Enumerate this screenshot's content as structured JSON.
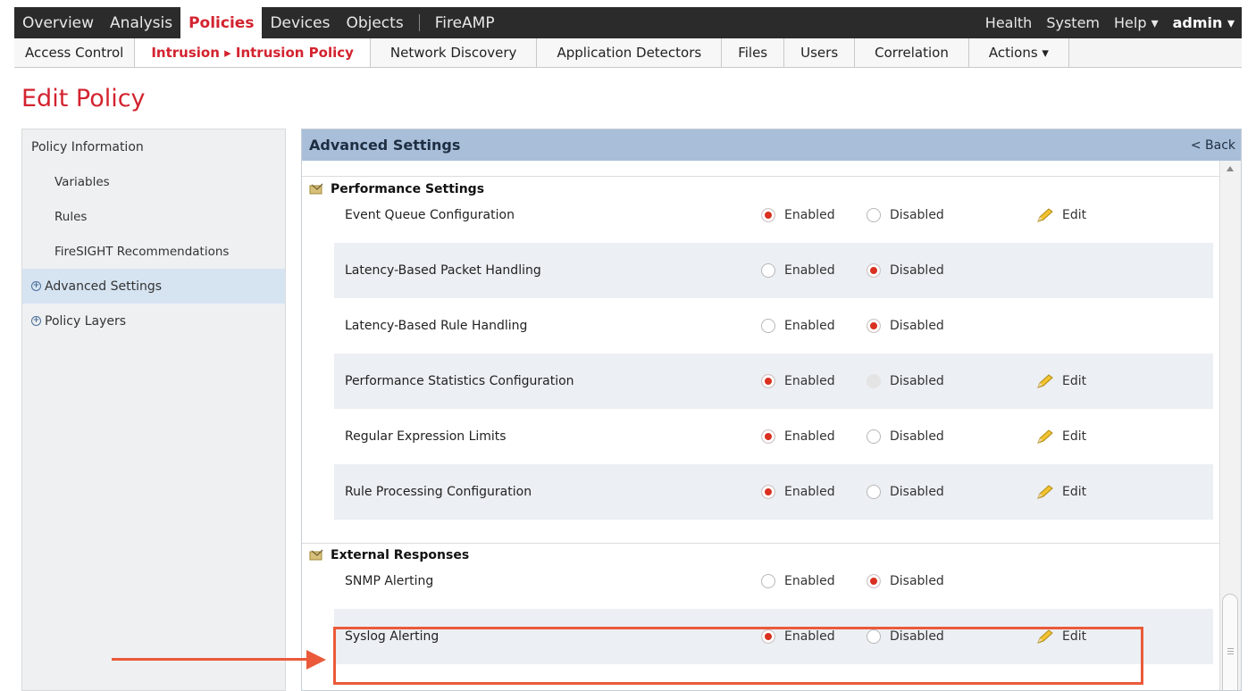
{
  "topnav": {
    "items": [
      "Overview",
      "Analysis",
      "Policies",
      "Devices",
      "Objects",
      "FireAMP"
    ],
    "active": "Policies",
    "right": [
      "Health",
      "System",
      "Help ▾",
      "admin ▾"
    ]
  },
  "subnav": {
    "items": [
      "Access Control",
      "Intrusion ▸ Intrusion Policy",
      "Network Discovery",
      "Application Detectors",
      "Files",
      "Users",
      "Correlation",
      "Actions ▾"
    ]
  },
  "page_title": "Edit Policy",
  "sidebar": {
    "items": [
      "Policy Information",
      "Variables",
      "Rules",
      "FireSIGHT Recommendations",
      "Advanced Settings",
      "Policy Layers"
    ]
  },
  "panel": {
    "title": "Advanced Settings",
    "back": "< Back",
    "sections": [
      {
        "title": "Performance Settings",
        "rows": [
          {
            "label": "Event Queue Configuration",
            "selected": "Enabled",
            "edit": "Edit"
          },
          {
            "label": "Latency-Based Packet Handling",
            "selected": "Disabled",
            "edit": ""
          },
          {
            "label": "Latency-Based Rule Handling",
            "selected": "Disabled",
            "edit": ""
          },
          {
            "label": "Performance Statistics Configuration",
            "selected": "Enabled",
            "edit": "Edit"
          },
          {
            "label": "Regular Expression Limits",
            "selected": "Enabled",
            "edit": "Edit"
          },
          {
            "label": "Rule Processing Configuration",
            "selected": "Enabled",
            "edit": "Edit"
          }
        ]
      },
      {
        "title": "External Responses",
        "rows": [
          {
            "label": "SNMP Alerting",
            "selected": "Disabled",
            "edit": ""
          },
          {
            "label": "Syslog Alerting",
            "selected": "Enabled",
            "edit": "Edit"
          }
        ]
      }
    ],
    "option_enabled": "Enabled",
    "option_disabled": "Disabled"
  },
  "colors": {
    "accent_red": "#d3232f",
    "header_blue": "#a9bfd9",
    "annotation": "#ea5a3a"
  }
}
